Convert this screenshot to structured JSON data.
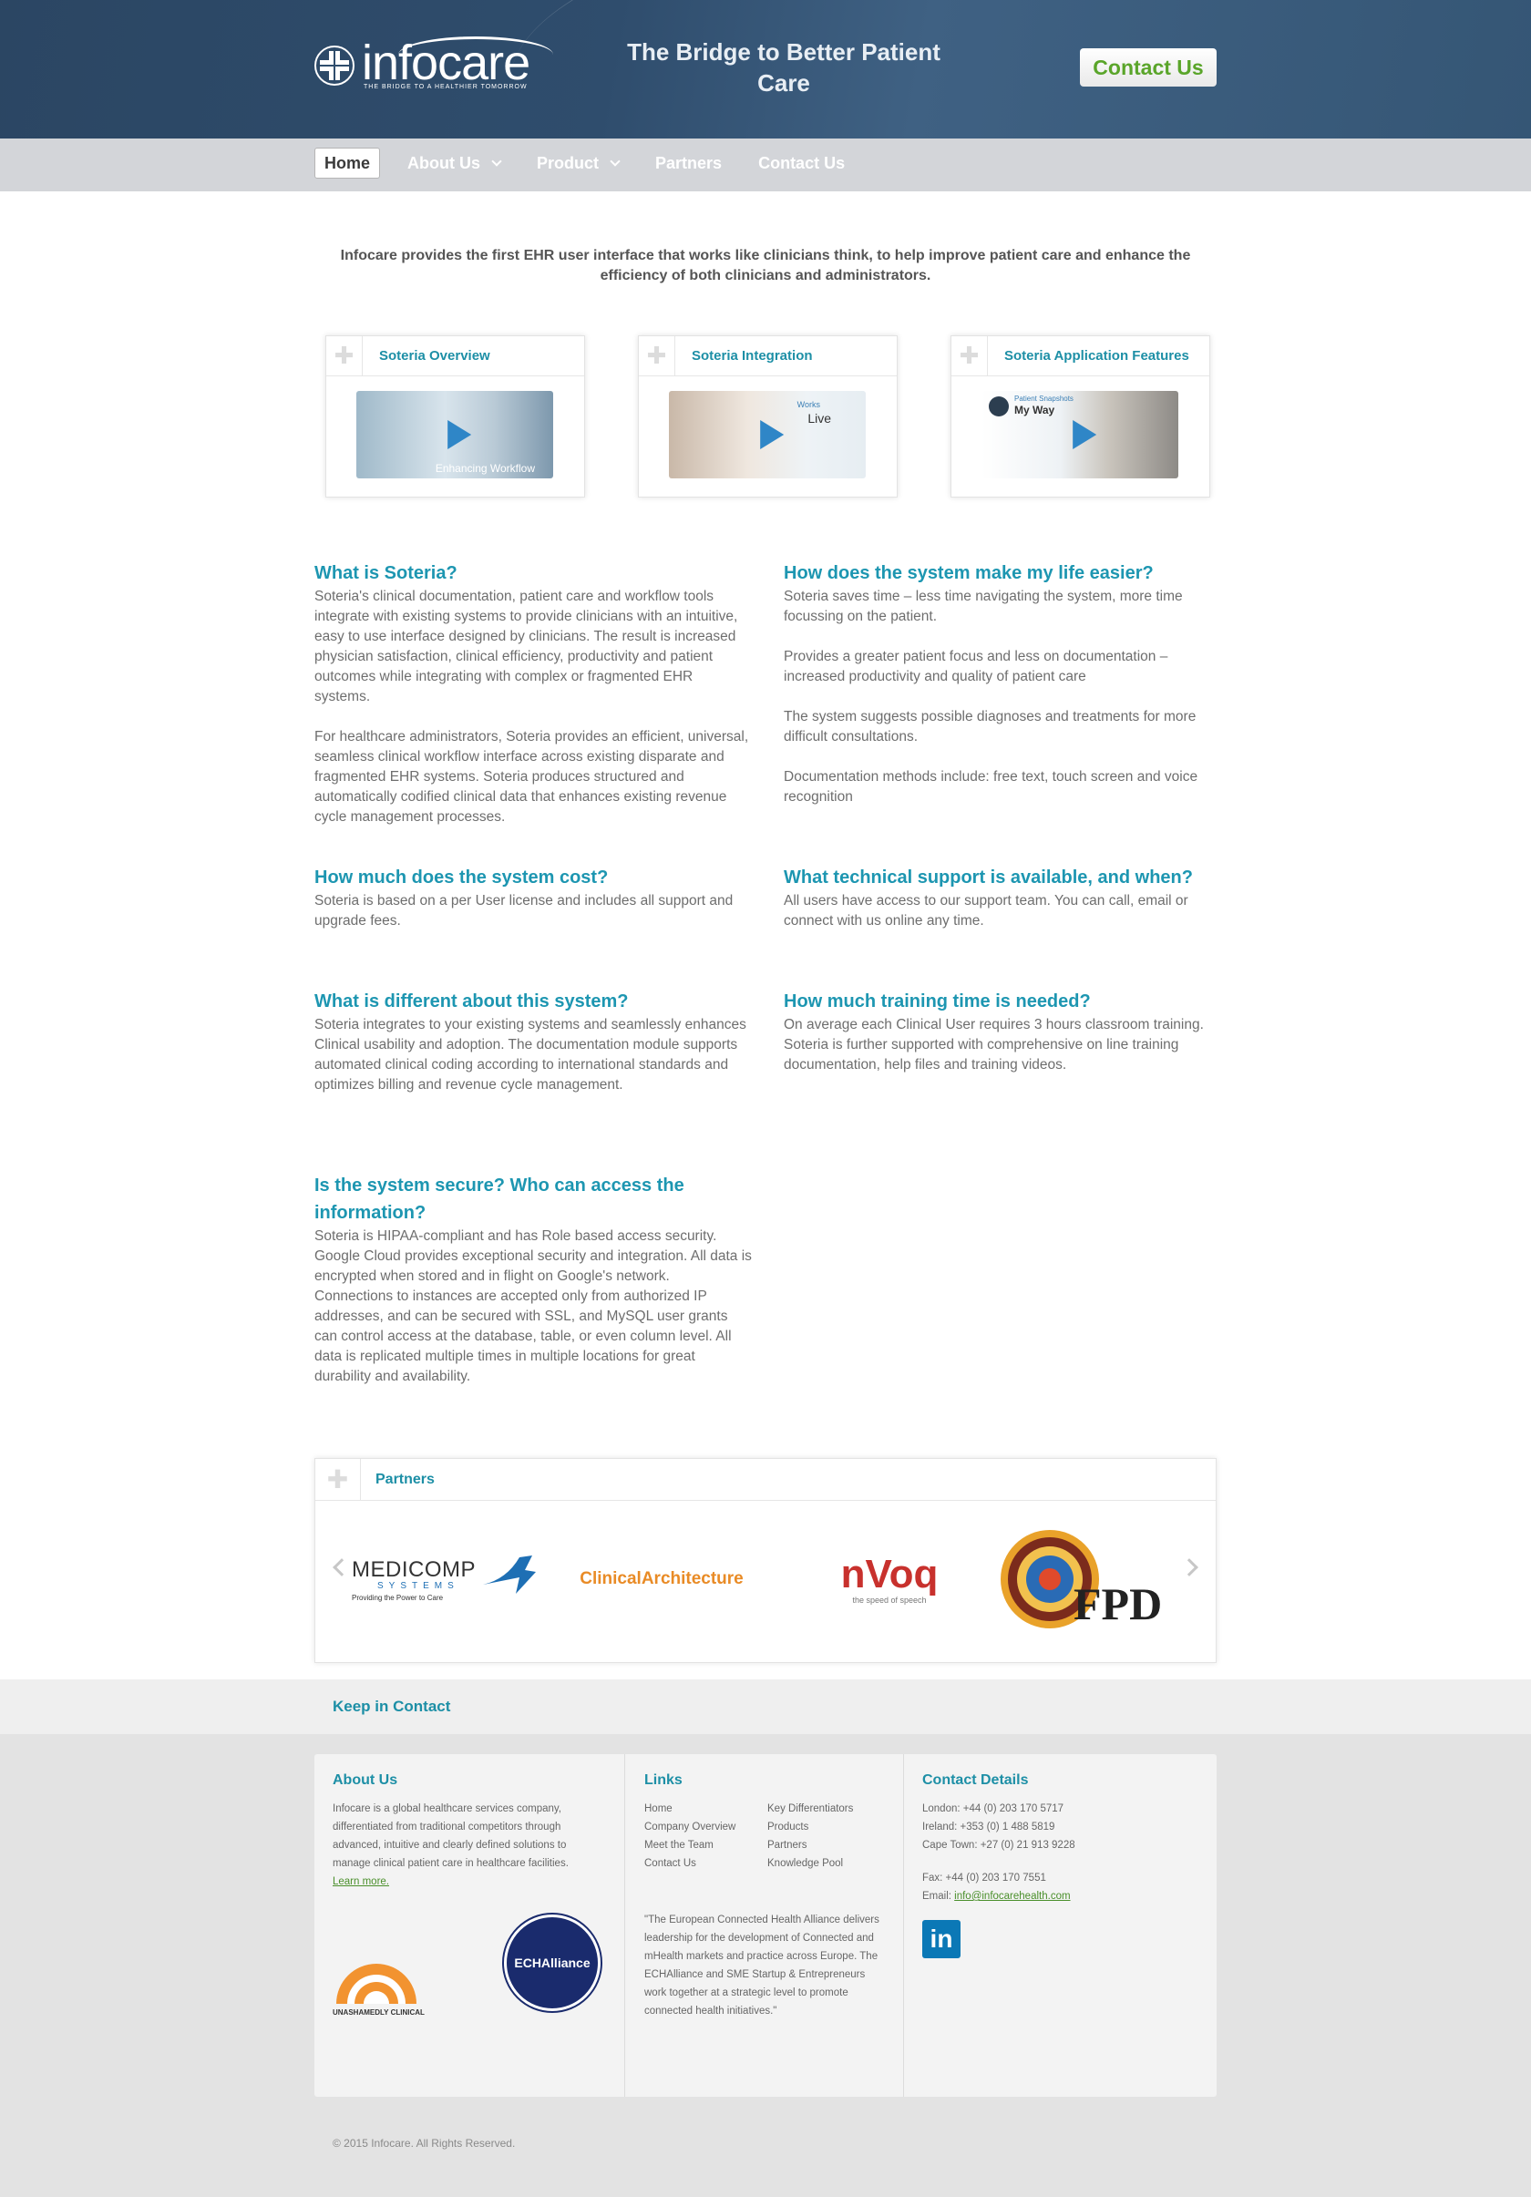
{
  "header": {
    "logo_text": "infocare",
    "logo_tagline": "THE BRIDGE TO A HEALTHIER TOMORROW",
    "slogan": "The Bridge to Better Patient Care",
    "contact_button": "Contact Us"
  },
  "nav": {
    "items": [
      {
        "label": "Home"
      },
      {
        "label": "About Us"
      },
      {
        "label": "Product"
      },
      {
        "label": "Partners"
      },
      {
        "label": "Contact Us"
      }
    ]
  },
  "intro": "Infocare provides the first EHR user interface that works like clinicians think, to help improve patient care and enhance the efficiency of both clinicians and administrators.",
  "videos": [
    {
      "title": "Soteria Overview",
      "caption": "Enhancing Workflow"
    },
    {
      "title": "Soteria Integration",
      "caption_small": "Works",
      "caption": "Live"
    },
    {
      "title": "Soteria Application Features",
      "caption_small": "Patient Snapshots",
      "caption": "My Way"
    }
  ],
  "faq": {
    "q1": {
      "title": "What is Soteria?",
      "p1": "Soteria's clinical documentation, patient care and workflow tools integrate with existing systems to provide clinicians with an intuitive, easy to use interface designed by clinicians.  The result is increased physician satisfaction, clinical efficiency, productivity and patient outcomes while integrating with complex or fragmented EHR systems.",
      "p2": "For healthcare administrators, Soteria provides an efficient, universal, seamless clinical workflow interface across existing disparate and fragmented EHR systems.   Soteria produces structured and automatically codified clinical data that enhances existing revenue cycle management processes."
    },
    "q2": {
      "title": "How does the system make my life easier?",
      "p1": "Soteria saves time – less time navigating the system, more time focussing on the patient.",
      "p2": "Provides a greater patient focus and less on documentation – increased productivity and quality of patient care",
      "p3": "The system suggests possible diagnoses and treatments for more difficult consultations.",
      "p4": "Documentation methods include:  free text, touch screen and voice recognition"
    },
    "q3": {
      "title": "How much does the system cost?",
      "p1": "Soteria is based on a per User license and includes all support and upgrade fees."
    },
    "q4": {
      "title": "What technical support is available, and when?",
      "p1": "All users have access to our support team. You can call, email or connect with us online any time."
    },
    "q5": {
      "title": "What is different about this system?",
      "p1": "Soteria integrates to your existing systems and seamlessly enhances Clinical usability and adoption. The documentation module supports automated clinical coding according to international standards and optimizes billing and revenue cycle management."
    },
    "q6": {
      "title": "How much training time is needed?",
      "p1": "On average each Clinical User requires 3 hours classroom training. Soteria is further supported with comprehensive on line training documentation, help files and training videos."
    },
    "q7": {
      "title": "Is the system secure? Who can access the information?",
      "p1": "Soteria is HIPAA-compliant and has Role based access security. Google Cloud provides exceptional security and integration. All data is encrypted when stored and in flight on Google's network. Connections to instances are accepted only from authorized IP addresses, and can be secured with SSL, and MySQL user grants can control access at the database, table, or even column level. All data is replicated multiple times in multiple locations for great durability and availability."
    }
  },
  "partners": {
    "title": "Partners",
    "logos": [
      {
        "name": "MEDICOMP",
        "sub": "SYSTEMS",
        "tag": "Providing the Power to Care"
      },
      {
        "name": "ClinicalArchitecture"
      },
      {
        "name": "nVoq",
        "tag": "the speed of speech"
      },
      {
        "name": "FPD"
      }
    ]
  },
  "keep_in_contact": "Keep in Contact",
  "footer": {
    "about": {
      "title": "About Us",
      "text": "Infocare is a global healthcare services company, differentiated from traditional competitors through advanced, intuitive and clearly defined solutions to manage clinical patient care in healthcare facilities.",
      "learn_more": "Learn more.",
      "badge1": "UNASHAMEDLY CLINICAL",
      "badge2": "ECHAlliance"
    },
    "links": {
      "title": "Links",
      "items": [
        "Home",
        "Key Differentiators",
        "Company Overview",
        "Products",
        "Meet the Team",
        "Partners",
        "Contact Us",
        "Knowledge Pool"
      ],
      "quote": "\"The European Connected Health Alliance delivers leadership for the development of Connected and mHealth markets and practice across Europe. The ECHAlliance and SME Startup & Entrepreneurs work together at a strategic level to promote connected health initiatives.\""
    },
    "contact": {
      "title": "Contact Details",
      "london": "London: +44 (0) 203 170 5717",
      "ireland": "Ireland: +353 (0) 1 488 5819",
      "capetown": "Cape Town: +27 (0) 21 913 9228",
      "fax": "Fax: +44 (0) 203 170 7551",
      "email_label": "Email: ",
      "email": "info@infocarehealth.com",
      "linkedin": "in"
    },
    "copyright": "© 2015 Infocare. All Rights Reserved."
  },
  "colors": {
    "accent": "#1d96b1",
    "header": "#2f4d6d",
    "green": "#5aa52a"
  }
}
